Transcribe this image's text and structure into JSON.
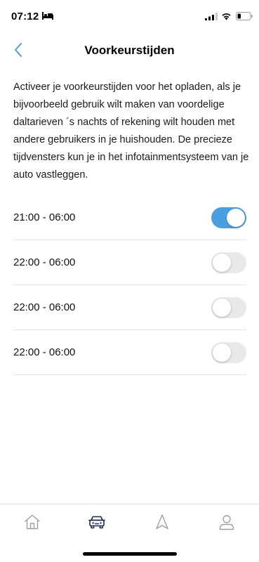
{
  "status_bar": {
    "time": "07:12",
    "icons": [
      "bed-icon",
      "signal-icon",
      "wifi-icon",
      "battery-icon"
    ]
  },
  "header": {
    "title": "Voorkeurstijden",
    "back_icon": "chevron-left-icon"
  },
  "description": "Activeer je voorkeurstijden voor het opladen, als je bijvoorbeeld gebruik wilt maken van voordelige daltarieven ´s nachts of rekening wilt houden met andere gebruikers in je huishouden. De precieze tijdvensters kun je in het infotainmentsysteem van je auto vastleggen.",
  "slots": [
    {
      "label": "21:00 - 06:00",
      "enabled": true
    },
    {
      "label": "22:00 - 06:00",
      "enabled": false
    },
    {
      "label": "22:00 - 06:00",
      "enabled": false
    },
    {
      "label": "22:00 - 06:00",
      "enabled": false
    }
  ],
  "tab_bar": {
    "tabs": [
      {
        "icon": "home-icon",
        "active": false
      },
      {
        "icon": "car-icon",
        "active": true
      },
      {
        "icon": "navigation-icon",
        "active": false
      },
      {
        "icon": "profile-icon",
        "active": false
      }
    ]
  },
  "colors": {
    "accent": "#4a9fe3",
    "active_tab": "#1d2a4d",
    "inactive_tab": "#9aa0a6",
    "toggle_off": "#e9e9ea"
  }
}
